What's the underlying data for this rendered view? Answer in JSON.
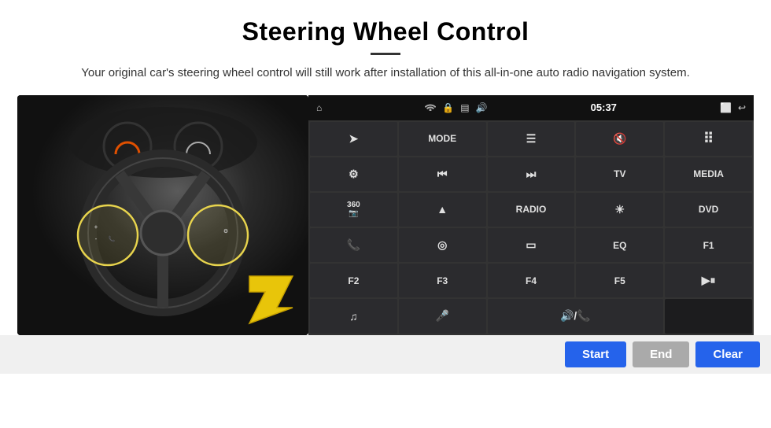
{
  "header": {
    "title": "Steering Wheel Control",
    "subtitle": "Your original car's steering wheel control will still work after installation of this all-in-one auto radio navigation system."
  },
  "statusBar": {
    "home": "⌂",
    "wifi": "WiFi",
    "lock": "🔒",
    "sd": "💾",
    "bluetooth": "🔊",
    "time": "05:37",
    "window": "⬜",
    "back": "↩"
  },
  "grid": [
    {
      "icon": "➤",
      "label": "",
      "col": 1
    },
    {
      "icon": "",
      "label": "MODE",
      "col": 1
    },
    {
      "icon": "≡",
      "label": "",
      "col": 1
    },
    {
      "icon": "🔇",
      "label": "",
      "col": 1
    },
    {
      "icon": "⠿",
      "label": "",
      "col": 1
    },
    {
      "icon": "⚙",
      "label": "",
      "col": 1
    },
    {
      "icon": "⏮",
      "label": "",
      "col": 1
    },
    {
      "icon": "⏭",
      "label": "",
      "col": 1
    },
    {
      "icon": "",
      "label": "TV",
      "col": 1
    },
    {
      "icon": "",
      "label": "MEDIA",
      "col": 1
    },
    {
      "icon": "360",
      "label": "",
      "col": 1
    },
    {
      "icon": "▲",
      "label": "",
      "col": 1
    },
    {
      "icon": "",
      "label": "RADIO",
      "col": 1
    },
    {
      "icon": "☀",
      "label": "",
      "col": 1
    },
    {
      "icon": "",
      "label": "DVD",
      "col": 1
    },
    {
      "icon": "📞",
      "label": "",
      "col": 1
    },
    {
      "icon": "◎",
      "label": "",
      "col": 1
    },
    {
      "icon": "▭",
      "label": "",
      "col": 1
    },
    {
      "icon": "",
      "label": "EQ",
      "col": 1
    },
    {
      "icon": "",
      "label": "F1",
      "col": 1
    },
    {
      "icon": "",
      "label": "F2",
      "col": 1
    },
    {
      "icon": "",
      "label": "F3",
      "col": 1
    },
    {
      "icon": "",
      "label": "F4",
      "col": 1
    },
    {
      "icon": "",
      "label": "F5",
      "col": 1
    },
    {
      "icon": "▶⏸",
      "label": "",
      "col": 1
    },
    {
      "icon": "♫",
      "label": "",
      "col": 1
    },
    {
      "icon": "🎤",
      "label": "",
      "col": 1
    },
    {
      "icon": "🔊/📞",
      "label": "",
      "col": 2
    },
    {
      "icon": "",
      "label": "",
      "col": 0
    }
  ],
  "buttons": {
    "start": "Start",
    "end": "End",
    "clear": "Clear"
  }
}
